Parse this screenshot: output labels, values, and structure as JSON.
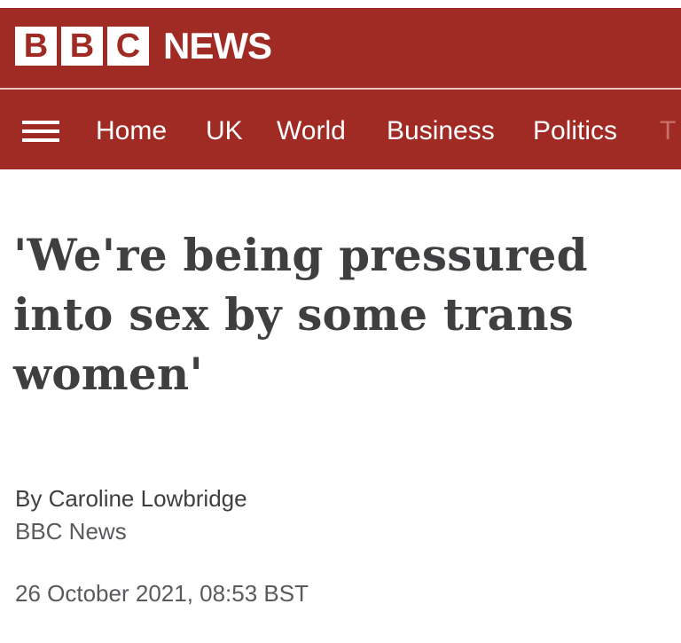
{
  "brand": {
    "logo_letters": [
      "B",
      "B",
      "C"
    ],
    "section": "NEWS",
    "primary_color": "#a02a24"
  },
  "nav": {
    "menu_icon": "hamburger-menu-icon",
    "items": [
      {
        "label": "Home"
      },
      {
        "label": "UK"
      },
      {
        "label": "World"
      },
      {
        "label": "Business"
      },
      {
        "label": "Politics"
      },
      {
        "label": "T"
      }
    ]
  },
  "article": {
    "headline_lines": [
      "'We're being pressured",
      "into sex by some trans",
      "women'"
    ],
    "byline": "By Caroline Lowbridge",
    "source": "BBC News",
    "timestamp": "26 October 2021, 08:53 BST"
  }
}
